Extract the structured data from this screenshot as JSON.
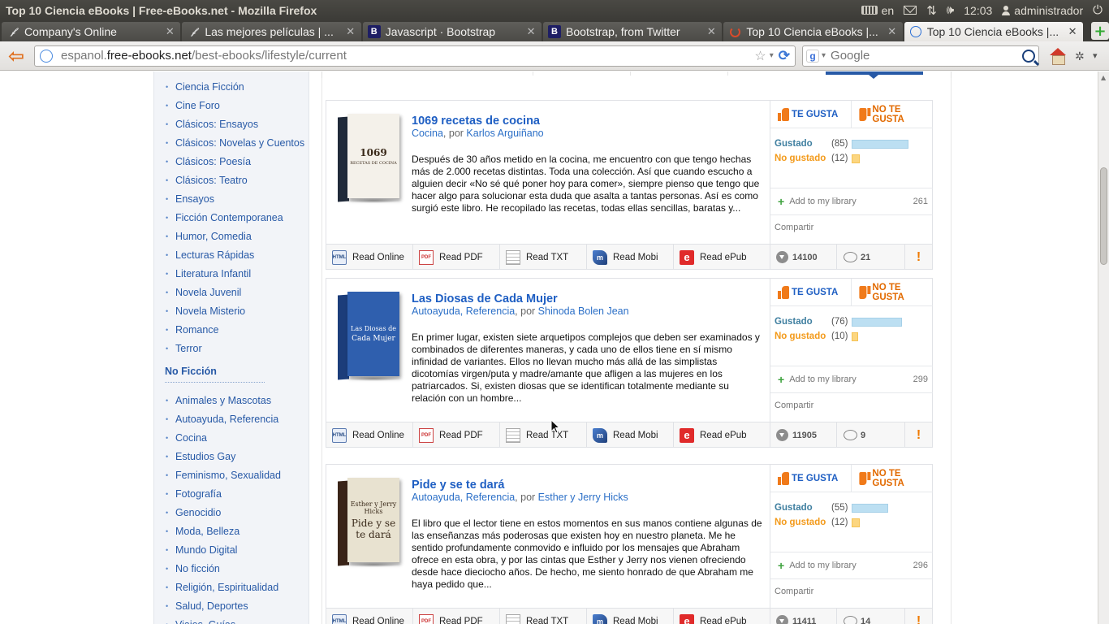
{
  "os_bar": {
    "window_title": "Top 10 Ciencia eBooks | Free-eBooks.net - Mozilla Firefox",
    "keyboard_layout": "en",
    "time": "12:03",
    "user": "administrador"
  },
  "tabs": [
    {
      "label": "Company's Online",
      "favicon": "script-icon",
      "active": false
    },
    {
      "label": "Las mejores películas | ...",
      "favicon": "script-icon",
      "active": false
    },
    {
      "label": "Javascript · Bootstrap",
      "favicon": "bootstrap-icon",
      "active": false
    },
    {
      "label": "Bootstrap, from Twitter",
      "favicon": "bootstrap-icon",
      "active": false
    },
    {
      "label": "Top 10 Ciencia eBooks |...",
      "favicon": "loading-icon",
      "active": false
    },
    {
      "label": "Top 10 Ciencia eBooks |...",
      "favicon": "globe-icon",
      "active": true
    }
  ],
  "navbar": {
    "url_prefix": "espanol.",
    "url_domain": "free-ebooks.net",
    "url_path": "/best-ebooks/lifestyle/current",
    "search_placeholder": "Google"
  },
  "sidebar": {
    "fiction_items": [
      "Ciencia Ficción",
      "Cine Foro",
      "Clásicos: Ensayos",
      "Clásicos: Novelas y Cuentos",
      "Clásicos: Poesía",
      "Clásicos: Teatro",
      "Ensayos",
      "Ficción Contemporanea",
      "Humor, Comedia",
      "Lecturas Rápidas",
      "Literatura Infantil",
      "Novela Juvenil",
      "Novela Misterio",
      "Romance",
      "Terror"
    ],
    "nonfiction_heading": "No Ficción",
    "nonfiction_items": [
      "Animales y Mascotas",
      "Autoayuda, Referencia",
      "Cocina",
      "Estudios Gay",
      "Feminismo, Sexualidad",
      "Fotografía",
      "Genocidio",
      "Moda, Belleza",
      "Mundo Digital",
      "No ficción",
      "Religión, Espiritualidad",
      "Salud, Deportes",
      "Viajes, Guías"
    ]
  },
  "labels": {
    "like": "TE GUSTA",
    "dislike": "NO TE GUSTA",
    "liked": "Gustado",
    "disliked": "No gustado",
    "add_library": "Add to my library",
    "share": "Compartir",
    "by": ", por ",
    "read_online": "Read Online",
    "read_pdf": "Read PDF",
    "read_txt": "Read TXT",
    "read_mobi": "Read Mobi",
    "read_epub": "Read ePub",
    "report": "!"
  },
  "books": [
    {
      "title": "1069 recetas de cocina",
      "category": "Cocina",
      "author": "Karlos Arguiñano",
      "description": "Después de 30 años metido en la cocina, me encuentro con que tengo hechas más de 2.000 recetas distintas. Toda una colección. Así que cuando escucho a alguien decir «No sé qué poner hoy para comer», siempre pienso que tengo que hacer algo para solucionar esta duda que asalta a tantas personas. Así es como surgió este libro. He recopilado las recetas, todas ellas sencillas, baratas y...",
      "likes": "(85)",
      "dislikes": "(12)",
      "likes_value": 85,
      "dislikes_value": 12,
      "library_count": "261",
      "downloads": "14100",
      "comments": "21",
      "cover_lines": [
        "1069",
        "RECETAS DE COCINA"
      ],
      "cover_color": "#f4f1ea",
      "spine_color": "#202a3a"
    },
    {
      "title": "Las Diosas de Cada Mujer",
      "category": "Autoayuda, Referencia",
      "author": "Shinoda Bolen Jean",
      "description": "En primer lugar, existen siete arquetipos complejos que deben ser examinados y combinados de diferentes maneras, y cada uno de ellos tiene en sí mismo infinidad de variantes. Ellos no llevan mucho más allá de las simplistas dicotomías virgen/puta y madre/amante que afligen a las mujeres en los patriarcados. Si, existen diosas que se identifican totalmente mediante su relación con un hombre...",
      "likes": "(76)",
      "dislikes": "(10)",
      "likes_value": 76,
      "dislikes_value": 10,
      "library_count": "299",
      "downloads": "11905",
      "comments": "9",
      "cover_lines": [
        "Las Diosas de",
        "Cada Mujer"
      ],
      "cover_color": "#2f5fae",
      "spine_color": "#1c3d7a"
    },
    {
      "title": "Pide y se te dará",
      "category": "Autoayuda, Referencia",
      "author": "Esther y Jerry Hicks",
      "description": "El libro que el lector tiene en estos momentos en sus manos contiene algunas de las enseñanzas más poderosas que existen hoy en nuestro planeta. Me he sentido profundamente conmovido e influido por los mensajes que Abraham ofrece en esta obra, y por las cintas que Esther y Jerry nos vienen ofreciendo desde hace dieciocho años. De hecho, me siento honrado de que Abraham me haya pedido que...",
      "likes": "(55)",
      "dislikes": "(12)",
      "likes_value": 55,
      "dislikes_value": 12,
      "library_count": "296",
      "downloads": "11411",
      "comments": "14",
      "cover_lines": [
        "Esther y Jerry Hicks",
        "Pide y se te dará"
      ],
      "cover_color": "#e8e2d0",
      "spine_color": "#3a2418"
    }
  ],
  "colors": {
    "link_blue": "#1f5fc3",
    "like_blue": "#bcdff2",
    "dislike_orange": "#fcd680",
    "accent_orange": "#f07a1a"
  }
}
